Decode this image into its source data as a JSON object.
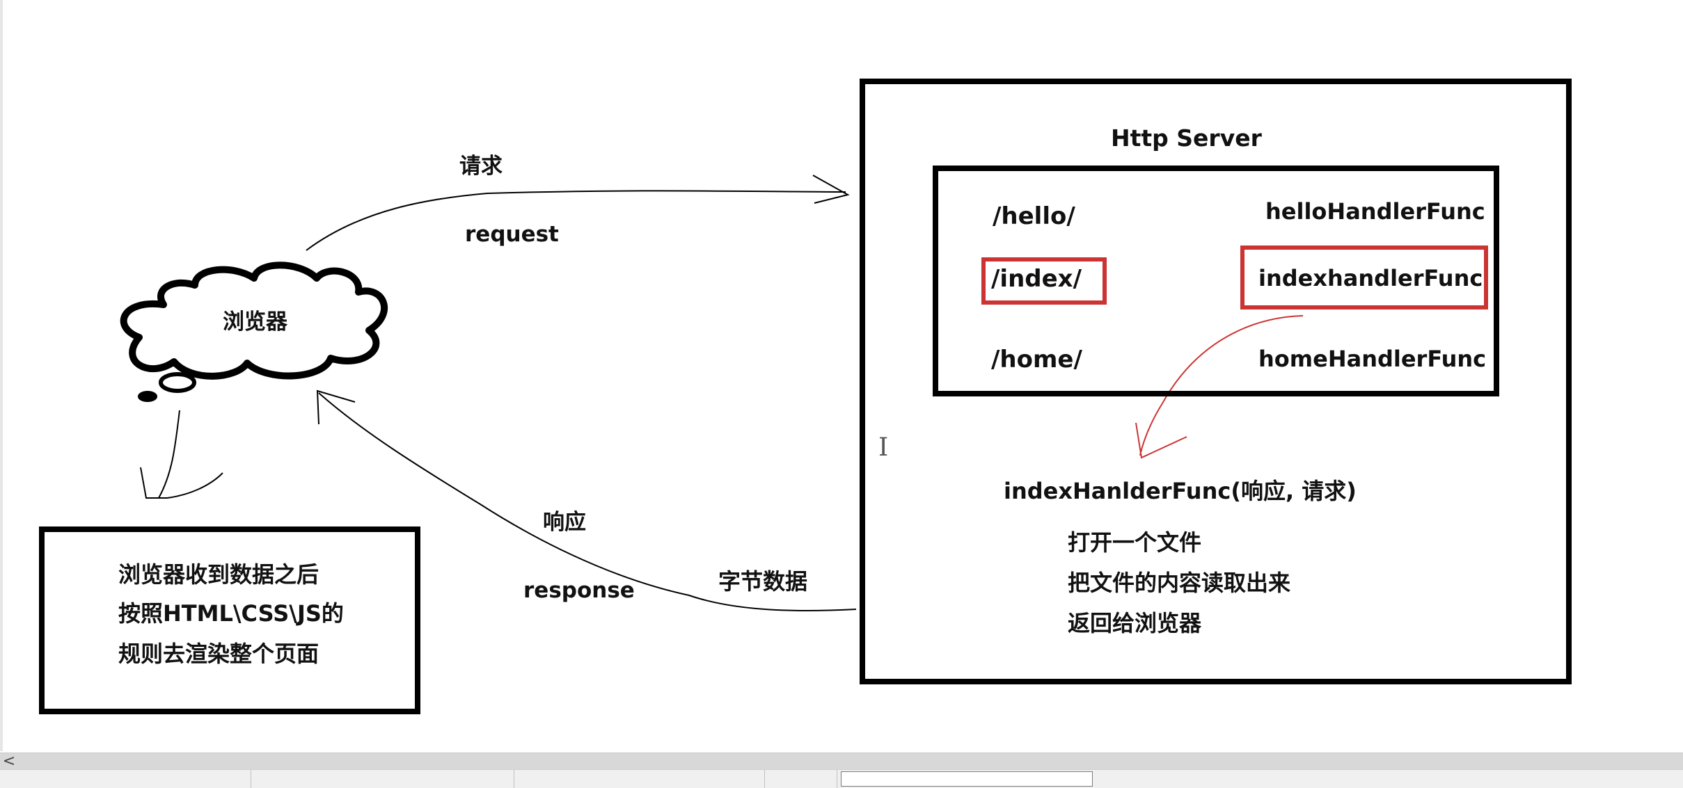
{
  "diagram": {
    "request_cn": "请求",
    "request_en": "request",
    "browser_label": "浏览器",
    "response_cn": "响应",
    "response_en": "response",
    "bytes_label": "字节数据",
    "browser_note": {
      "line1": "浏览器收到数据之后",
      "line2": "按照HTML\\CSS\\JS的",
      "line3": "规则去渲染整个页面"
    },
    "server_title": "Http Server",
    "routes": [
      {
        "path": "/hello/",
        "handler": "helloHandlerFunc",
        "highlight": false
      },
      {
        "path": "/index/",
        "handler": "indexhandlerFunc",
        "highlight": true
      },
      {
        "path": "/home/",
        "handler": "homeHandlerFunc",
        "highlight": false
      }
    ],
    "handler_signature": "indexHanlderFunc(响应, 请求)",
    "handler_steps": [
      "打开一个文件",
      "把文件的内容读取出来",
      "返回给浏览器"
    ],
    "cursor_glyph": "I"
  },
  "colors": {
    "stroke": "#000000",
    "highlight": "#cc3333",
    "scrollbar": "#d8d8d8",
    "statusbar": "#f0f0f0"
  },
  "scrollbar": {
    "left_arrow": "<"
  }
}
